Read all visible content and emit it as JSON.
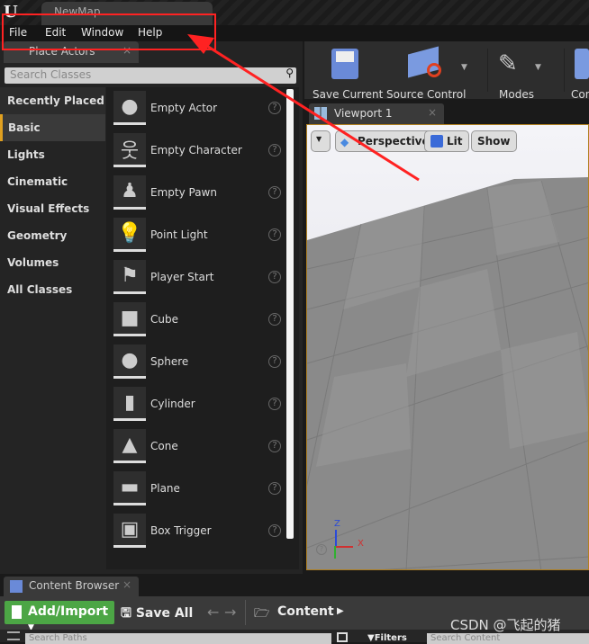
{
  "window": {
    "map_tab": "NewMap"
  },
  "menu": [
    "File",
    "Edit",
    "Window",
    "Help"
  ],
  "place_actors": {
    "tab": "Place Actors",
    "search_placeholder": "Search Classes",
    "categories": [
      "Recently Placed",
      "Basic",
      "Lights",
      "Cinematic",
      "Visual Effects",
      "Geometry",
      "Volumes",
      "All Classes"
    ],
    "selected_category": "Basic",
    "items": [
      "Empty Actor",
      "Empty Character",
      "Empty Pawn",
      "Point Light",
      "Player Start",
      "Cube",
      "Sphere",
      "Cylinder",
      "Cone",
      "Plane",
      "Box Trigger"
    ]
  },
  "toolbar": {
    "save_current": "Save Current",
    "source_control": "Source Control",
    "modes": "Modes",
    "content": "Con"
  },
  "viewport": {
    "tab": "Viewport 1",
    "perspective": "Perspective",
    "lit": "Lit",
    "show": "Show",
    "axis_z": "Z",
    "axis_x": "X"
  },
  "content_browser": {
    "tab": "Content Browser",
    "add_import": "Add/Import",
    "save_all": "Save All",
    "path": "Content",
    "search_paths": "Search Paths",
    "filters": "Filters",
    "search_content": "Search Content"
  },
  "watermark": "CSDN @飞起的猪",
  "colors": {
    "accent_green": "#4ca645",
    "annotation_red": "#ff2222",
    "selected_bar": "#e0a020"
  }
}
